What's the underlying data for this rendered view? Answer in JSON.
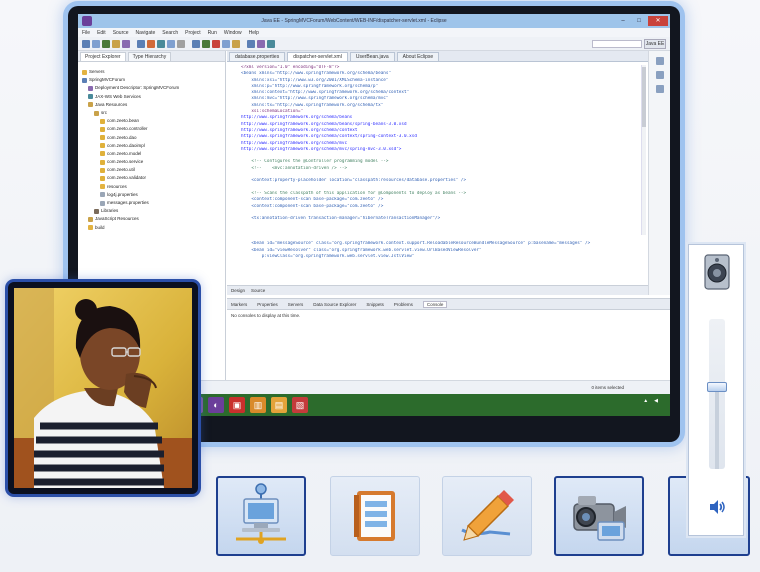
{
  "window": {
    "title": "Java EE - SpringMVCForum/WebContent/WEB-INF/dispatcher-servlet.xml - Eclipse",
    "controls": {
      "minimize": "–",
      "maximize": "□",
      "close": "✕"
    }
  },
  "menubar": [
    "File",
    "Edit",
    "Source",
    "Navigate",
    "Search",
    "Project",
    "Run",
    "Window",
    "Help"
  ],
  "toolbar": {
    "perspective_label": "Java EE"
  },
  "explorer": {
    "tabs": [
      "Project Explorer",
      "Type Hierarchy"
    ],
    "items": [
      {
        "label": "Servers",
        "indent": 1,
        "icon": "folder-icon"
      },
      {
        "label": "SpringMVCForum",
        "indent": 1,
        "icon": "project-icon"
      },
      {
        "label": "Deployment Descriptor: SpringMVCForum",
        "indent": 2,
        "icon": "descriptor-icon"
      },
      {
        "label": "JAX-WS Web Services",
        "indent": 2,
        "icon": "webservice-icon"
      },
      {
        "label": "Java Resources",
        "indent": 2,
        "icon": "java-resources-icon"
      },
      {
        "label": "src",
        "indent": 3,
        "icon": "package-folder-icon"
      },
      {
        "label": "com.zeeto.bean",
        "indent": 4,
        "icon": "package-icon"
      },
      {
        "label": "com.zeeto.controller",
        "indent": 4,
        "icon": "package-icon"
      },
      {
        "label": "com.zeeto.dao",
        "indent": 4,
        "icon": "package-icon"
      },
      {
        "label": "com.zeeto.daoimpl",
        "indent": 4,
        "icon": "package-icon"
      },
      {
        "label": "com.zeeto.model",
        "indent": 4,
        "icon": "package-icon"
      },
      {
        "label": "com.zeeto.service",
        "indent": 4,
        "icon": "package-icon"
      },
      {
        "label": "com.zeeto.util",
        "indent": 4,
        "icon": "package-icon"
      },
      {
        "label": "com.zeeto.validator",
        "indent": 4,
        "icon": "package-icon"
      },
      {
        "label": "resources",
        "indent": 4,
        "icon": "folder-icon"
      },
      {
        "label": "log4j.properties",
        "indent": 4,
        "icon": "file-icon"
      },
      {
        "label": "messages.properties",
        "indent": 4,
        "icon": "file-icon"
      },
      {
        "label": "Libraries",
        "indent": 3,
        "icon": "library-icon"
      },
      {
        "label": "JavaScript Resources",
        "indent": 2,
        "icon": "js-icon"
      },
      {
        "label": "build",
        "indent": 2,
        "icon": "folder-icon"
      }
    ]
  },
  "editor": {
    "tabs": [
      "database.properties",
      "dispatcher-servlet.xml",
      "UserBean.java",
      "About Eclipse"
    ],
    "active_tab": 1,
    "lines": [
      {
        "text": "<?xml version=\"1.0\" encoding=\"UTF-8\"?>",
        "color": "#7a2b7a"
      },
      {
        "text": "<beans xmlns=\"http://www.springframework.org/schema/beans\"",
        "color": "#2f5fb3"
      },
      {
        "text": "    xmlns:xsi=\"http://www.w3.org/2001/XMLSchema-instance\"",
        "color": "#2f5fb3"
      },
      {
        "text": "    xmlns:p=\"http://www.springframework.org/schema/p\"",
        "color": "#2f5fb3"
      },
      {
        "text": "    xmlns:context=\"http://www.springframework.org/schema/context\"",
        "color": "#2f5fb3"
      },
      {
        "text": "    xmlns:mvc=\"http://www.springframework.org/schema/mvc\"",
        "color": "#2f5fb3"
      },
      {
        "text": "    xmlns:tx=\"http://www.springframework.org/schema/tx\"",
        "color": "#2f5fb3"
      },
      {
        "text": "    xsi:schemaLocation=\"",
        "color": "#7a2b7a"
      },
      {
        "text": "http://www.springframework.org/schema/beans",
        "color": "#2a2aff"
      },
      {
        "text": "http://www.springframework.org/schema/beans/spring-beans-3.0.xsd",
        "color": "#2a2aff"
      },
      {
        "text": "http://www.springframework.org/schema/context",
        "color": "#2a2aff"
      },
      {
        "text": "http://www.springframework.org/schema/context/spring-context-3.0.xsd",
        "color": "#2a2aff"
      },
      {
        "text": "http://www.springframework.org/schema/mvc",
        "color": "#2a2aff"
      },
      {
        "text": "http://www.springframework.org/schema/mvc/spring-mvc-3.0.xsd\">",
        "color": "#2a2aff"
      },
      {
        "text": "",
        "color": "#333333"
      },
      {
        "text": "    <!-- Configures the @Controller programming model -->",
        "color": "#3f7f5f"
      },
      {
        "text": "    <!--    <mvc:annotation-driven /> -->",
        "color": "#3f7f5f"
      },
      {
        "text": "",
        "color": "#333333"
      },
      {
        "text": "    <context:property-placeholder location=\"classpath:resources/database.properties\" />",
        "color": "#2f5fb3"
      },
      {
        "text": "",
        "color": "#333333"
      },
      {
        "text": "    <!-- Scans the classpath of this application for @Components to deploy as beans -->",
        "color": "#3f7f5f"
      },
      {
        "text": "    <context:component-scan base-package=\"com.zeeto\" />",
        "color": "#2f5fb3"
      },
      {
        "text": "    <context:component-scan base-package=\"com.zeeto\" />",
        "color": "#2f5fb3"
      },
      {
        "text": "",
        "color": "#333333"
      },
      {
        "text": "    <tx:annotation-driven transaction-manager=\"hibernateTransactionManager\"/>",
        "color": "#2f5fb3"
      },
      {
        "text": "",
        "color": "#333333"
      },
      {
        "text": "",
        "color": "#333333"
      },
      {
        "text": "",
        "color": "#333333"
      },
      {
        "text": "    <bean id=\"messageSource\" class=\"org.springframework.context.support.ReloadableResourceBundleMessageSource\" p:basename=\"messages\" />",
        "color": "#2f5fb3"
      },
      {
        "text": "    <bean id=\"viewResolver\" class=\"org.springframework.web.servlet.view.UrlBasedViewResolver\"",
        "color": "#2f5fb3"
      },
      {
        "text": "        p:viewClass=\"org.springframework.web.servlet.view.JstlView\"",
        "color": "#2f5fb3"
      }
    ],
    "bottom_tabs": [
      "Design",
      "Source"
    ]
  },
  "console": {
    "tabs": [
      "Markers",
      "Properties",
      "Servers",
      "Data Source Explorer",
      "Snippets",
      "Problems",
      "Console"
    ],
    "body": "No consoles to display at this time."
  },
  "statusbar": {
    "left": "",
    "right_text": "0 items selected",
    "zoom": ""
  },
  "taskbar": {
    "apps": [
      {
        "icon": "file-explorer-icon",
        "color": "#e7b93b",
        "glyph": "▤"
      },
      {
        "icon": "ie-icon",
        "color": "#3b8fd6",
        "glyph": "e"
      },
      {
        "icon": "store-icon",
        "color": "#3aa0d8",
        "glyph": "◧"
      },
      {
        "icon": "chrome-icon",
        "color": "#4a9a3a",
        "glyph": "◉"
      },
      {
        "icon": "media-icon",
        "color": "#222222",
        "glyph": "●"
      },
      {
        "icon": "paint-icon",
        "color": "#7a5aa0",
        "glyph": "▦"
      },
      {
        "icon": "eclipse-icon",
        "color": "#6b3f9a",
        "glyph": "◐"
      },
      {
        "icon": "pdf-icon",
        "color": "#c9302c",
        "glyph": "▣"
      },
      {
        "icon": "notepad-icon",
        "color": "#d98a2a",
        "glyph": "▥"
      },
      {
        "icon": "folder-icon",
        "color": "#e3a33a",
        "glyph": "▤"
      },
      {
        "icon": "app-icon",
        "color": "#c43b3b",
        "glyph": "▧"
      }
    ],
    "clock_time": "",
    "clock_date": ""
  },
  "bottom_buttons": [
    {
      "name": "share-desktop-button",
      "icon": "computer-network-icon",
      "selected": true
    },
    {
      "name": "document-button",
      "icon": "notebook-icon",
      "selected": false
    },
    {
      "name": "whiteboard-button",
      "icon": "pencil-icon",
      "selected": false
    },
    {
      "name": "video-button",
      "icon": "camcorder-icon",
      "selected": true
    },
    {
      "name": "volume-button",
      "icon": "speaker-icon",
      "selected": true
    }
  ],
  "volume": {
    "level": 0.55,
    "icon": "speaker-icon",
    "mute_icon": "speaker-mute-icon"
  },
  "colors": {
    "accent": "#1e3f8f",
    "window_glow": "#9fc3ef",
    "taskbar": "#2c6b2c",
    "close_button": "#c9433c"
  }
}
